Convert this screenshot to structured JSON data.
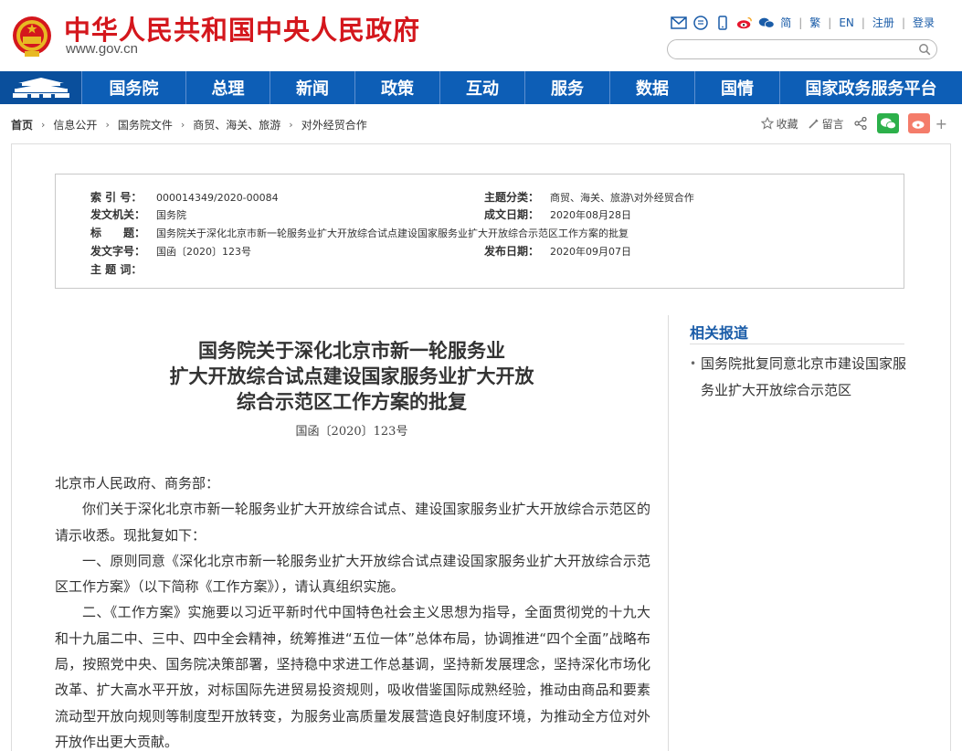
{
  "header": {
    "site_title": "中华人民共和国中央人民政府",
    "site_url": "www.gov.cn",
    "lang_links": [
      "简",
      "繁",
      "EN",
      "注册",
      "登录"
    ],
    "search_placeholder": ""
  },
  "nav": {
    "items": [
      "国务院",
      "总理",
      "新闻",
      "政策",
      "互动",
      "服务",
      "数据",
      "国情",
      "国家政务服务平台"
    ]
  },
  "breadcrumb": [
    "首页",
    "信息公开",
    "国务院文件",
    "商贸、海关、旅游",
    "对外经贸合作"
  ],
  "page_tools": {
    "favorite": "收藏",
    "comment": "留言"
  },
  "meta": {
    "index_label": "索 引 号：",
    "index_value": "000014349/2020-00084",
    "topic_label": "主题分类：",
    "topic_value": "商贸、海关、旅游\\对外经贸合作",
    "issuer_label": "发文机关：",
    "issuer_value": "国务院",
    "date_written_label": "成文日期：",
    "date_written_value": "2020年08月28日",
    "title_label": "标　　题：",
    "title_value": "国务院关于深化北京市新一轮服务业扩大开放综合试点建设国家服务业扩大开放综合示范区工作方案的批复",
    "doc_no_label": "发文字号：",
    "doc_no_value": "国函〔2020〕123号",
    "publish_date_label": "发布日期：",
    "publish_date_value": "2020年09月07日",
    "keywords_label": "主 题 词：",
    "keywords_value": ""
  },
  "article": {
    "title_line1": "国务院关于深化北京市新一轮服务业",
    "title_line2": "扩大开放综合试点建设国家服务业扩大开放",
    "title_line3": "综合示范区工作方案的批复",
    "doc_number": "国函〔2020〕123号",
    "salutation": "北京市人民政府、商务部：",
    "para1": "你们关于深化北京市新一轮服务业扩大开放综合试点、建设国家服务业扩大开放综合示范区的请示收悉。现批复如下：",
    "para2": "一、原则同意《深化北京市新一轮服务业扩大开放综合试点建设国家服务业扩大开放综合示范区工作方案》（以下简称《工作方案》），请认真组织实施。",
    "para3": "二、《工作方案》实施要以习近平新时代中国特色社会主义思想为指导，全面贯彻党的十九大和十九届二中、三中、四中全会精神，统筹推进“五位一体”总体布局，协调推进“四个全面”战略布局，按照党中央、国务院决策部署，坚持稳中求进工作总基调，坚持新发展理念，坚持深化市场化改革、扩大高水平开放，对标国际先进贸易投资规则，吸收借鉴国际成熟经验，推动由商品和要素流动型开放向规则等制度型开放转变，为服务业高质量发展营造良好制度环境，为推动全方位对外开放作出更大贡献。"
  },
  "sidebar": {
    "title": "相关报道",
    "items": [
      "国务院批复同意北京市建设国家服务业扩大开放综合示范区"
    ]
  },
  "colors": {
    "brand_red": "#d4171d",
    "nav_blue": "#0d5eb6",
    "link_blue": "#1a5ca8"
  }
}
